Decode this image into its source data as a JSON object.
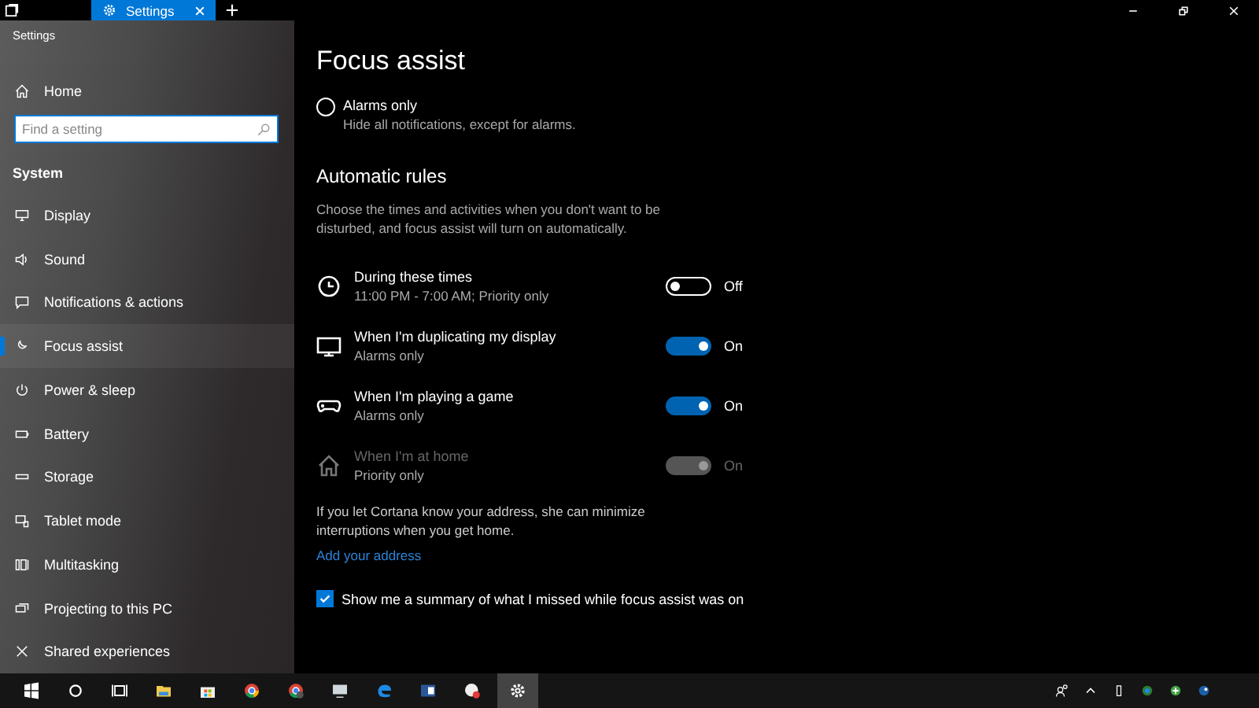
{
  "tab": {
    "title": "Settings"
  },
  "app_title": "Settings",
  "sidebar": {
    "home": "Home",
    "search": {
      "placeholder": "Find a setting"
    },
    "section": "System",
    "items": [
      {
        "label": "Display",
        "selected": false
      },
      {
        "label": "Sound",
        "selected": false
      },
      {
        "label": "Notifications & actions",
        "selected": false
      },
      {
        "label": "Focus assist",
        "selected": true
      },
      {
        "label": "Power & sleep",
        "selected": false
      },
      {
        "label": "Battery",
        "selected": false
      },
      {
        "label": "Storage",
        "selected": false
      },
      {
        "label": "Tablet mode",
        "selected": false
      },
      {
        "label": "Multitasking",
        "selected": false
      },
      {
        "label": "Projecting to this PC",
        "selected": false
      },
      {
        "label": "Shared experiences",
        "selected": false
      }
    ]
  },
  "main": {
    "title": "Focus assist",
    "radio": {
      "label": "Alarms only",
      "description": "Hide all notifications, except for alarms.",
      "selected": false
    },
    "rules_heading": "Automatic rules",
    "rules_description": "Choose the times and activities when you don't want to be disturbed, and focus assist will turn on automatically.",
    "rules": [
      {
        "title": "During these times",
        "subtitle": "11:00 PM - 7:00 AM; Priority only",
        "on": false,
        "status": "Off",
        "disabled": false
      },
      {
        "title": "When I'm duplicating my display",
        "subtitle": "Alarms only",
        "on": true,
        "status": "On",
        "disabled": false
      },
      {
        "title": "When I'm playing a game",
        "subtitle": "Alarms only",
        "on": true,
        "status": "On",
        "disabled": false
      },
      {
        "title": "When I'm at home",
        "subtitle": "Priority only",
        "on": true,
        "status": "On",
        "disabled": true
      }
    ],
    "cortana_note": "If you let Cortana know your address, she can minimize interruptions when you get home.",
    "link": "Add your address",
    "summary_checkbox": {
      "label": "Show me a summary of what I missed while focus assist was on",
      "checked": true
    }
  }
}
